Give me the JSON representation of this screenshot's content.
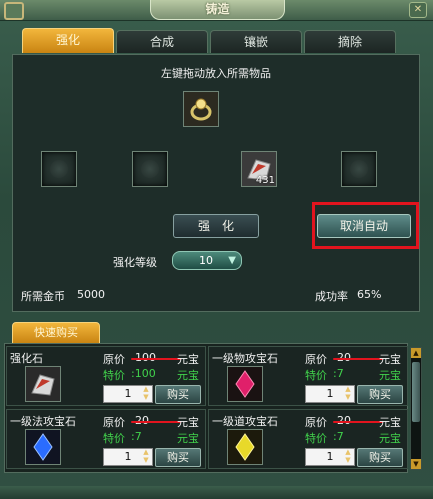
{
  "window": {
    "title": "铸造",
    "close_icon": "close-icon"
  },
  "tabs": [
    {
      "label": "强化",
      "active": true
    },
    {
      "label": "合成",
      "active": false
    },
    {
      "label": "镶嵌",
      "active": false
    },
    {
      "label": "摘除",
      "active": false
    }
  ],
  "forge": {
    "hint": "左键拖动放入所需物品",
    "target_item_icon": "ring-icon",
    "material_slots": [
      {
        "icon": "rune-slot-icon",
        "filled": false
      },
      {
        "icon": "rune-slot-icon",
        "filled": false
      },
      {
        "icon": "strengthen-stone-icon",
        "filled": true,
        "count": "431"
      },
      {
        "icon": "rune-slot-icon",
        "filled": false
      }
    ],
    "strengthen_button": "强　化",
    "cancel_auto_button": "取消自动",
    "level_label": "强化等级",
    "level_value": "10",
    "gold_label": "所需金币",
    "gold_value": "5000",
    "success_label": "成功率",
    "success_value": "65%"
  },
  "quick_buy": {
    "tab_label": "快速购买",
    "items": [
      {
        "name": "强化石",
        "orig_label": "原价",
        "orig_price": "100",
        "special_label": "特价",
        "special_price": ":100",
        "currency": "元宝",
        "qty": "1",
        "buy": "购买",
        "icon": "strengthen-stone-icon",
        "color": "#d33"
      },
      {
        "name": "一级物攻宝石",
        "orig_label": "原价",
        "orig_price": "20",
        "special_label": "特价",
        "special_price": ":7",
        "currency": "元宝",
        "qty": "1",
        "buy": "购买",
        "icon": "red-gem-icon",
        "color": "#e0206a"
      },
      {
        "name": "一级法攻宝石",
        "orig_label": "原价",
        "orig_price": "20",
        "special_label": "特价",
        "special_price": ":7",
        "currency": "元宝",
        "qty": "1",
        "buy": "购买",
        "icon": "blue-gem-icon",
        "color": "#2a6cff"
      },
      {
        "name": "一级道攻宝石",
        "orig_label": "原价",
        "orig_price": "20",
        "special_label": "特价",
        "special_price": ":7",
        "currency": "元宝",
        "qty": "1",
        "buy": "购买",
        "icon": "yellow-gem-icon",
        "color": "#e8d92a"
      }
    ]
  }
}
